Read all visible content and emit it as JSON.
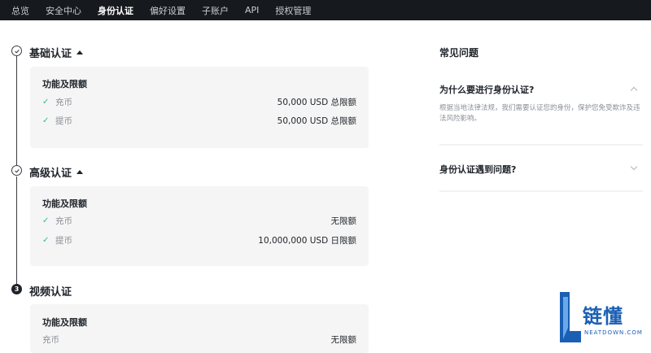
{
  "nav": {
    "items": [
      "总览",
      "安全中心",
      "身份认证",
      "偏好设置",
      "子账户",
      "API",
      "授权管理"
    ],
    "active_index": 2
  },
  "sections": [
    {
      "title": "基础认证",
      "status": "completed",
      "card_title": "功能及限额",
      "rows": [
        {
          "label": "充币",
          "value": "50,000 USD 总限额"
        },
        {
          "label": "提币",
          "value": "50,000 USD 总限额"
        }
      ]
    },
    {
      "title": "高级认证",
      "status": "completed",
      "card_title": "功能及限额",
      "rows": [
        {
          "label": "充币",
          "value": "无限额"
        },
        {
          "label": "提币",
          "value": "10,000,000 USD 日限额"
        }
      ]
    },
    {
      "title": "视频认证",
      "status": "pending",
      "step_number": "3",
      "card_title": "功能及限额",
      "rows": [
        {
          "label": "充币",
          "value": "无限额"
        }
      ]
    }
  ],
  "faq": {
    "title": "常见问题",
    "items": [
      {
        "question": "为什么要进行身份认证?",
        "expanded": true,
        "answer": "根据当地法律法规，我们需要认证您的身份，保护您免受欺诈及违法风险影响。"
      },
      {
        "question": "身份认证遇到问题?",
        "expanded": false
      }
    ]
  },
  "watermark": {
    "text": "链懂",
    "subtext": "NEATDOWN.COM"
  },
  "colors": {
    "nav_bg": "#16191e",
    "check_green": "#2ebd85",
    "card_bg": "#f5f5f5",
    "brand_blue": "#1a5fb4"
  }
}
